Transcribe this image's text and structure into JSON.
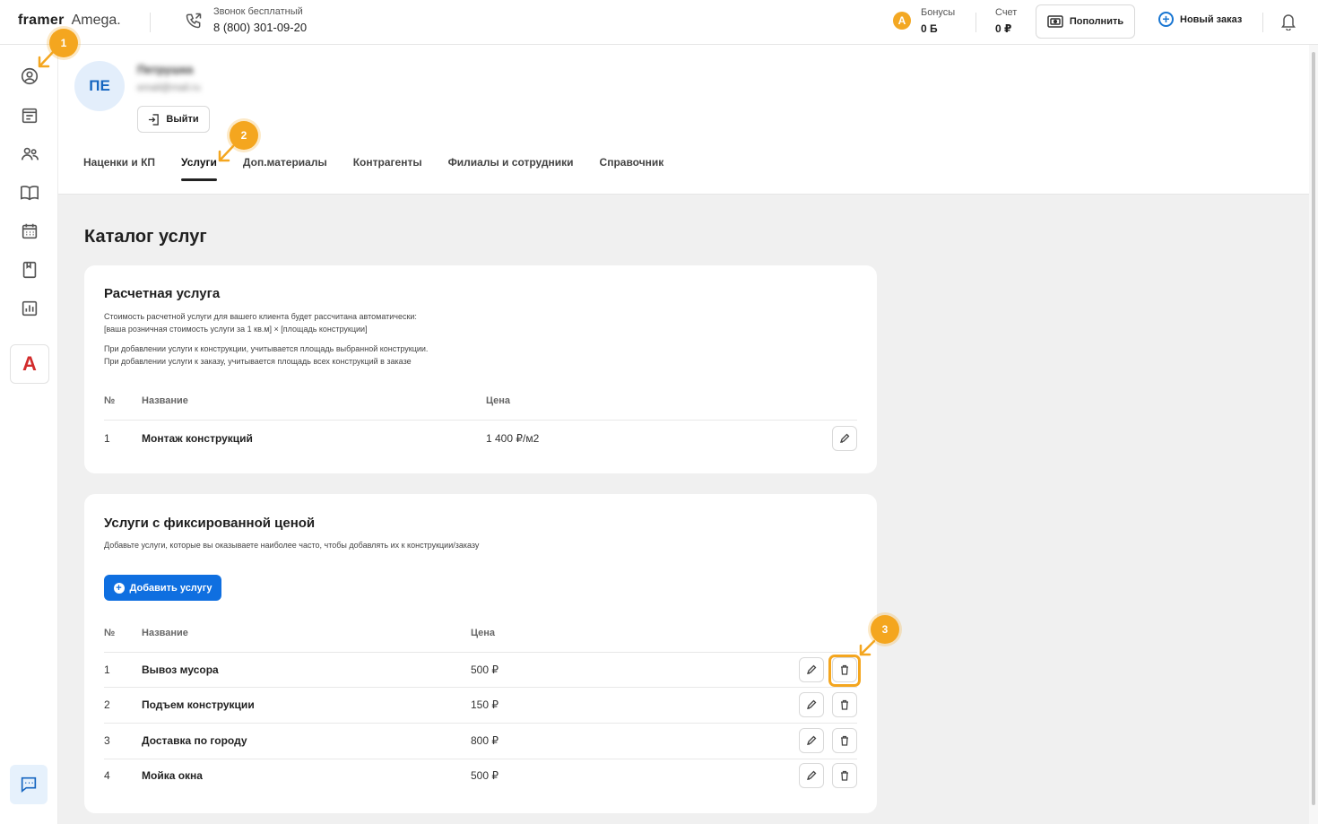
{
  "brand": {
    "part1": "framer",
    "part2": "Amega."
  },
  "phone": {
    "label": "Звонок бесплатный",
    "number": "8 (800) 301-09-20"
  },
  "bonus": {
    "icon_letter": "A",
    "label": "Бонусы",
    "value": "0 Б"
  },
  "account": {
    "label": "Счет",
    "value": "0 ₽"
  },
  "topbar": {
    "topup_label": "Пополнить",
    "new_order_label": "Новый заказ"
  },
  "profile": {
    "initials": "ПЕ",
    "name": "Петрушка",
    "email": "email@mail.ru",
    "logout_label": "Выйти"
  },
  "tabs": [
    {
      "label": "Наценки и КП"
    },
    {
      "label": "Услуги",
      "active": true
    },
    {
      "label": "Доп.материалы"
    },
    {
      "label": "Контрагенты"
    },
    {
      "label": "Филиалы и сотрудники"
    },
    {
      "label": "Справочник"
    }
  ],
  "page_title": "Каталог услуг",
  "calc_card": {
    "title": "Расчетная услуга",
    "desc1": "Стоимость расчетной услуги для вашего клиента будет рассчитана автоматически:",
    "desc2": "[ваша розничная стоимость услуги за 1 кв.м] × [площадь конструкции]",
    "desc3": "При добавлении услуги к конструкции, учитывается площадь выбранной конструкции.",
    "desc4": "При добавлении услуги к заказу, учитывается площадь всех конструкций в заказе",
    "col_num": "№",
    "col_name": "Название",
    "col_price": "Цена",
    "rows": [
      {
        "num": "1",
        "name": "Монтаж конструкций",
        "price": "1 400 ₽/м2"
      }
    ]
  },
  "fixed_card": {
    "title": "Услуги с фиксированной ценой",
    "desc": "Добавьте услуги, которые вы оказываете наиболее часто, чтобы добавлять их к конструкции/заказу",
    "add_label": "Добавить услугу",
    "col_num": "№",
    "col_name": "Название",
    "col_price": "Цена",
    "rows": [
      {
        "num": "1",
        "name": "Вывоз мусора",
        "price": "500 ₽"
      },
      {
        "num": "2",
        "name": "Подъем конструкции",
        "price": "150 ₽"
      },
      {
        "num": "3",
        "name": "Доставка по городу",
        "price": "800 ₽"
      },
      {
        "num": "4",
        "name": "Мойка окна",
        "price": "500 ₽"
      }
    ]
  },
  "sidebar": {
    "brand_letter": "A"
  },
  "markers": [
    "1",
    "2",
    "3"
  ],
  "colors": {
    "accent": "#0f6fe0",
    "marker": "#f4a61f",
    "brand_red": "#d22c2c"
  }
}
